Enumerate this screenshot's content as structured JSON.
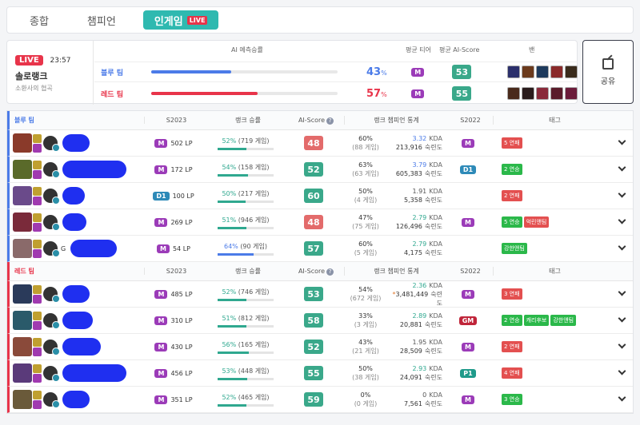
{
  "tabs": [
    {
      "label": "종합",
      "active": false
    },
    {
      "label": "챔피언",
      "active": false
    },
    {
      "label": "인게임",
      "active": true,
      "badge": "LIVE"
    }
  ],
  "summary": {
    "live_label": "LIVE",
    "time": "23:57",
    "mode": "솔로랭크",
    "map": "소환사의 협곡",
    "headers": {
      "prediction": "AI 예측승률",
      "avg_tier": "평균 티어",
      "avg_score": "평균 AI-Score",
      "ban": "밴"
    },
    "blue": {
      "name": "블루 팀",
      "percent": "43",
      "unit": "%",
      "ratio": 0.43,
      "tier": "M",
      "score": "53"
    },
    "red": {
      "name": "레드 팀",
      "percent": "57",
      "unit": "%",
      "ratio": 0.57,
      "tier": "M",
      "score": "55"
    }
  },
  "share_label": "공유",
  "columns": {
    "season": "S2023",
    "winrate": "랭크 승률",
    "ai": "AI-Score",
    "champ": "랭크 챔피언 통계",
    "prev": "S2022",
    "tag": "태그",
    "help": "?"
  },
  "blue_team_label": "블루 팀",
  "red_team_label": "레드 팀",
  "colors": {
    "blue": "#4b7be8",
    "red": "#e8344a",
    "teal": "#2fb9b0",
    "tier_m": "#9b3bb8",
    "tier_d": "#2e8ab8",
    "tier_gm": "#c0253a",
    "tier_p": "#1f9a8a",
    "score_red": "#e36b6b",
    "score_green": "#3aa88a",
    "tag_red": "#e35050",
    "tag_green": "#2bb84a"
  },
  "blue_players": [
    {
      "tier": "M",
      "tier_color": "#9b3bb8",
      "lp": "502 LP",
      "wr": "52%",
      "games": "(719 게임)",
      "wr_ratio": 0.52,
      "score": "48",
      "score_color": "#e36b6b",
      "cpct": "60%",
      "cgames": "(88 게임)",
      "kda": "3.32",
      "kda_color": "#4b7be8",
      "cs": "213,916",
      "prev": "M",
      "prev_color": "#9b3bb8",
      "tags": [
        {
          "t": "5 연패",
          "c": "#e35050"
        }
      ],
      "redact_w": 34
    },
    {
      "tier": "M",
      "tier_color": "#9b3bb8",
      "lp": "172 LP",
      "wr": "54%",
      "games": "(158 게임)",
      "wr_ratio": 0.54,
      "score": "52",
      "score_color": "#3aa88a",
      "cpct": "63%",
      "cgames": "(63 게임)",
      "kda": "3.79",
      "kda_color": "#4b7be8",
      "cs": "605,383",
      "prev": "D1",
      "prev_color": "#2e8ab8",
      "tags": [
        {
          "t": "2 연승",
          "c": "#2bb84a"
        }
      ],
      "redact_w": 80
    },
    {
      "tier": "D1",
      "tier_color": "#2e8ab8",
      "lp": "100 LP",
      "wr": "50%",
      "games": "(217 게임)",
      "wr_ratio": 0.5,
      "score": "60",
      "score_color": "#3aa88a",
      "cpct": "50%",
      "cgames": "(4 게임)",
      "kda": "1.91",
      "kda_color": "#555",
      "cs": "5,358",
      "prev": "",
      "prev_color": "",
      "tags": [
        {
          "t": "2 연패",
          "c": "#e35050"
        }
      ],
      "redact_w": 28
    },
    {
      "tier": "M",
      "tier_color": "#9b3bb8",
      "lp": "269 LP",
      "wr": "51%",
      "games": "(946 게임)",
      "wr_ratio": 0.51,
      "score": "48",
      "score_color": "#e36b6b",
      "cpct": "47%",
      "cgames": "(75 게임)",
      "kda": "2.79",
      "kda_color": "#2fa88f",
      "cs": "126,496",
      "prev": "M",
      "prev_color": "#9b3bb8",
      "tags": [
        {
          "t": "5 연승",
          "c": "#2bb84a"
        },
        {
          "t": "억린앤팀",
          "c": "#e35050"
        }
      ],
      "redact_w": 30
    },
    {
      "tier": "M",
      "tier_color": "#9b3bb8",
      "lp": "54 LP",
      "wr": "64%",
      "games": "(90 게임)",
      "wr_ratio": 0.64,
      "score": "57",
      "score_color": "#3aa88a",
      "cpct": "60%",
      "cgames": "(5 게임)",
      "kda": "2.79",
      "kda_color": "#2fa88f",
      "cs": "4,175",
      "prev": "",
      "prev_color": "",
      "tags": [
        {
          "t": "강한앤팀",
          "c": "#2bb84a"
        }
      ],
      "redact_w": 58,
      "name_prefix": "G"
    }
  ],
  "red_players": [
    {
      "tier": "M",
      "tier_color": "#9b3bb8",
      "lp": "485 LP",
      "wr": "52%",
      "games": "(746 게임)",
      "wr_ratio": 0.52,
      "score": "53",
      "score_color": "#3aa88a",
      "cpct": "54%",
      "cgames": "(672 게임)",
      "kda": "2.36",
      "kda_color": "#2fa88f",
      "cs": "3,481,449",
      "star": true,
      "prev": "M",
      "prev_color": "#9b3bb8",
      "tags": [
        {
          "t": "3 연패",
          "c": "#e35050"
        }
      ],
      "redact_w": 34
    },
    {
      "tier": "M",
      "tier_color": "#9b3bb8",
      "lp": "310 LP",
      "wr": "51%",
      "games": "(812 게임)",
      "wr_ratio": 0.51,
      "score": "58",
      "score_color": "#3aa88a",
      "cpct": "33%",
      "cgames": "(3 게임)",
      "kda": "2.89",
      "kda_color": "#2fa88f",
      "cs": "20,881",
      "prev": "GM",
      "prev_color": "#c0253a",
      "tags": [
        {
          "t": "2 연승",
          "c": "#2bb84a"
        },
        {
          "t": "캐리후보",
          "c": "#2bb84a"
        },
        {
          "t": "강한앤팀",
          "c": "#2bb84a"
        }
      ],
      "redact_w": 38
    },
    {
      "tier": "M",
      "tier_color": "#9b3bb8",
      "lp": "430 LP",
      "wr": "56%",
      "games": "(165 게임)",
      "wr_ratio": 0.56,
      "score": "52",
      "score_color": "#3aa88a",
      "cpct": "43%",
      "cgames": "(21 게임)",
      "kda": "1.95",
      "kda_color": "#555",
      "cs": "28,509",
      "prev": "M",
      "prev_color": "#9b3bb8",
      "tags": [
        {
          "t": "2 연패",
          "c": "#e35050"
        }
      ],
      "redact_w": 48
    },
    {
      "tier": "M",
      "tier_color": "#9b3bb8",
      "lp": "456 LP",
      "wr": "53%",
      "games": "(448 게임)",
      "wr_ratio": 0.53,
      "score": "55",
      "score_color": "#3aa88a",
      "cpct": "50%",
      "cgames": "(38 게임)",
      "kda": "2.93",
      "kda_color": "#2fa88f",
      "cs": "24,091",
      "prev": "P1",
      "prev_color": "#1f9a8a",
      "tags": [
        {
          "t": "4 연패",
          "c": "#e35050"
        }
      ],
      "redact_w": 80
    },
    {
      "tier": "M",
      "tier_color": "#9b3bb8",
      "lp": "351 LP",
      "wr": "52%",
      "games": "(465 게임)",
      "wr_ratio": 0.52,
      "score": "59",
      "score_color": "#3aa88a",
      "cpct": "0%",
      "cgames": "(0 게임)",
      "kda": "0",
      "kda_color": "#555",
      "cs": "7,561",
      "prev": "M",
      "prev_color": "#9b3bb8",
      "tags": [
        {
          "t": "3 연승",
          "c": "#2bb84a"
        }
      ],
      "redact_w": 34
    }
  ],
  "kda_label": "KDA",
  "cs_label": "숙련도"
}
